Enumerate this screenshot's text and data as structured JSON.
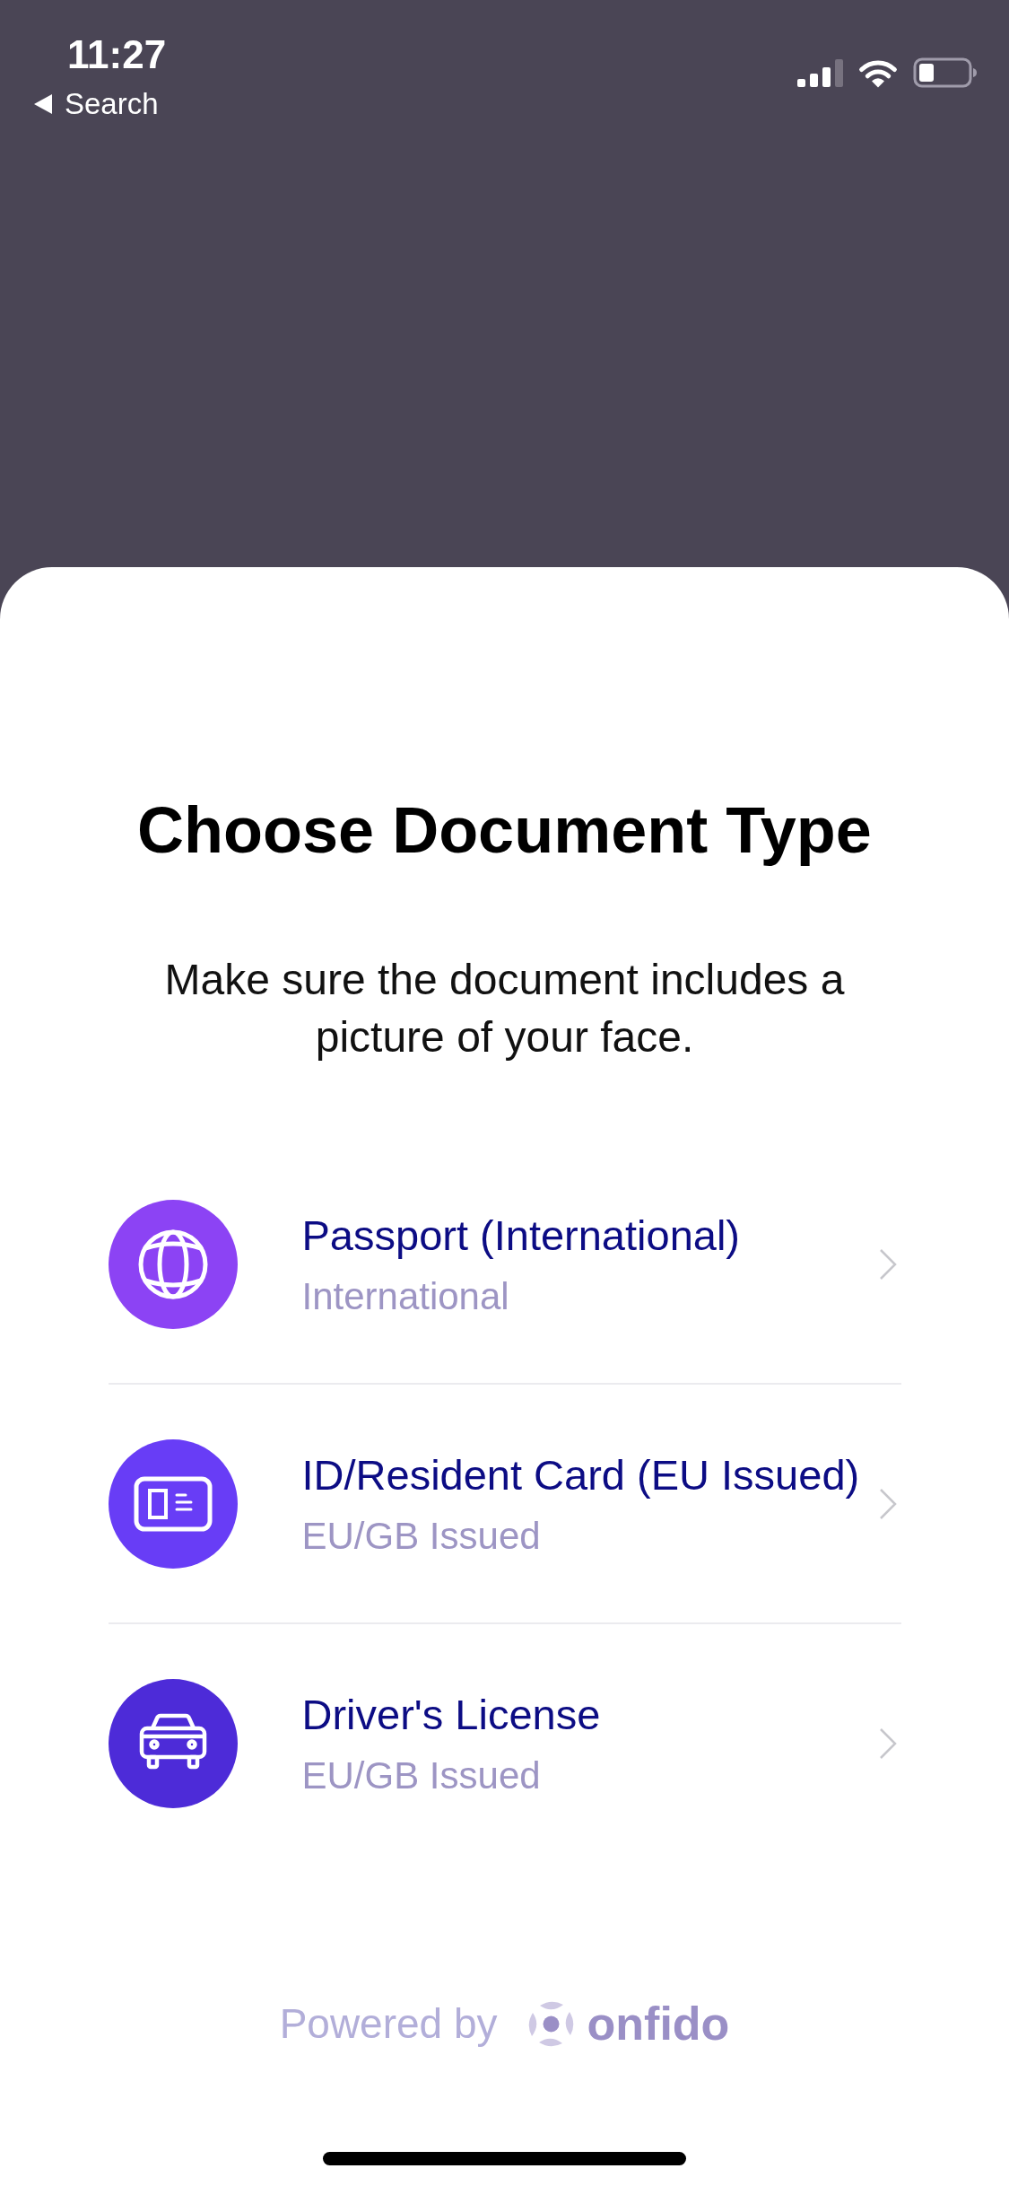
{
  "status_bar": {
    "time": "11:27",
    "back_label": "Search"
  },
  "title": "Choose Document Type",
  "subtitle": "Make sure the document includes a picture of your face.",
  "document_types": [
    {
      "title": "Passport (International)",
      "subtitle": "International",
      "color": "#8c43f4"
    },
    {
      "title": "ID/Resident Card (EU Issued)",
      "subtitle": "EU/GB Issued",
      "color": "#683df6"
    },
    {
      "title": "Driver's License",
      "subtitle": "EU/GB Issued",
      "color": "#4d2bd8"
    }
  ],
  "footer": {
    "powered_by": "Powered by",
    "brand": "onfido"
  }
}
